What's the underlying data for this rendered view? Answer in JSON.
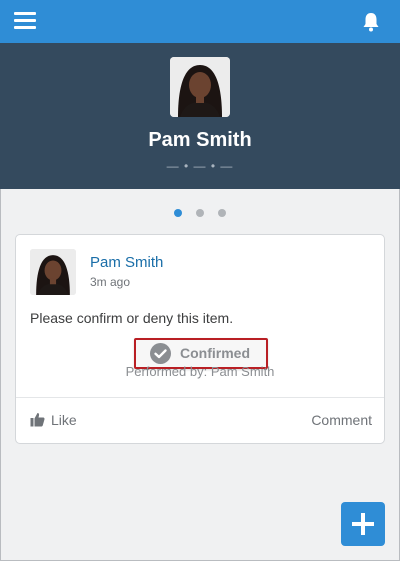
{
  "header": {
    "menu_icon": "hamburger-menu-icon",
    "notifications_icon": "bell-icon"
  },
  "profile": {
    "name": "Pam Smith",
    "subtitle": "— • — • —"
  },
  "carousel": {
    "page_count": 3,
    "active_page": 1
  },
  "post": {
    "author": "Pam Smith",
    "time": "3m ago",
    "body": "Please confirm or deny this item.",
    "confirm_label": "Confirmed",
    "performed_by": "Performed by: Pam Smith",
    "like_label": "Like",
    "comment_label": "Comment"
  },
  "colors": {
    "header_blue": "#2f8dd6",
    "hero_navy": "#344a5e",
    "link_blue": "#1a6ea8",
    "highlight_red": "#b91f24"
  }
}
